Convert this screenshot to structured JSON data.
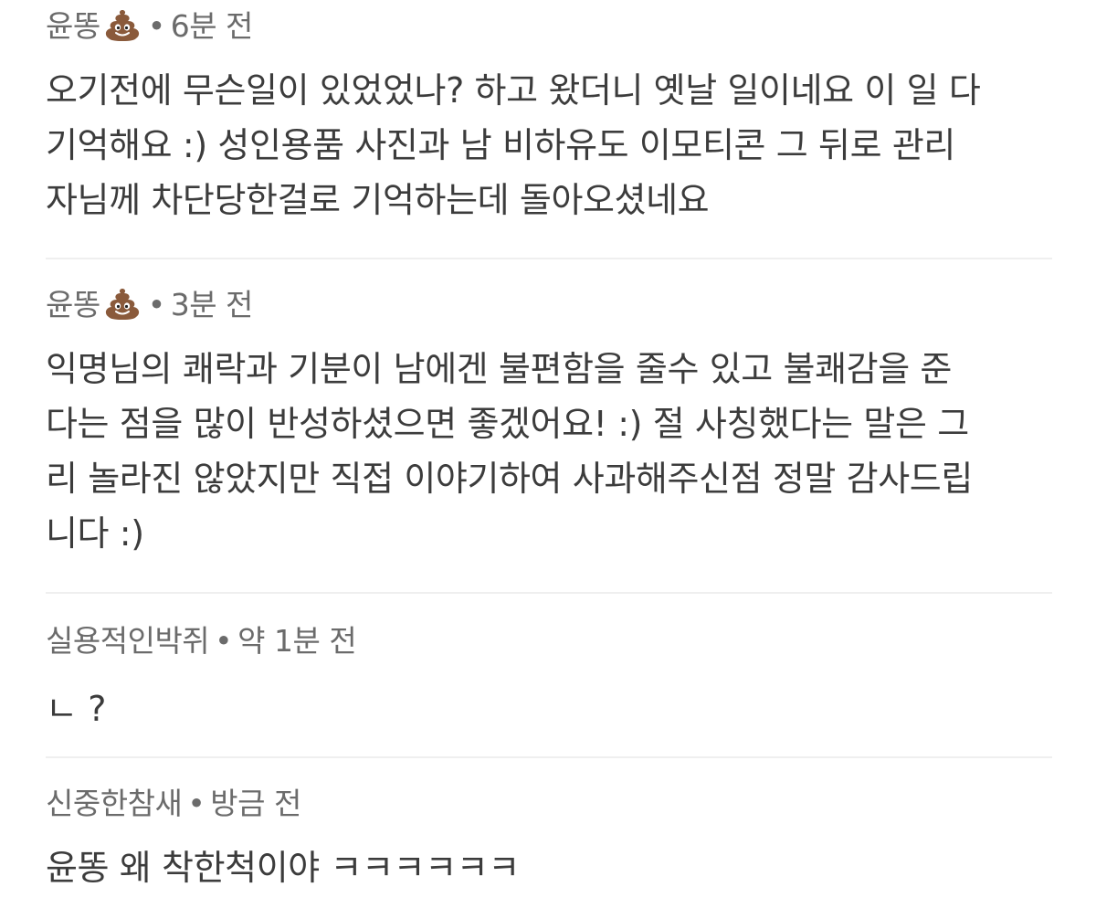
{
  "comments": [
    {
      "author": "윤똥",
      "author_icon": "poop-emoji-icon",
      "separator": "•",
      "time": "6분 전",
      "lines": [
        "오기전에 무슨일이 있었었나? 하고 왔더니 옛날 일이네요 이 일 다",
        "기억해요 :) 성인용품 사진과 남 비하유도 이모티콘 그 뒤로 관리",
        "자님께 차단당한걸로 기억하는데 돌아오셨네요"
      ]
    },
    {
      "author": "윤똥",
      "author_icon": "poop-emoji-icon",
      "separator": "•",
      "time": "3분 전",
      "lines": [
        "익명님의 쾌락과 기분이 남에겐 불편함을 줄수 있고 불쾌감을 준",
        "다는 점을 많이 반성하셨으면 좋겠어요! :) 절 사칭했다는 말은 그",
        "리 놀라진 않았지만 직접 이야기하여 사과해주신점 정말 감사드립",
        "니다 :)"
      ]
    },
    {
      "author": "실용적인박쥐",
      "separator": "•",
      "time": "약 1분 전",
      "lines": [
        "ㄴ ?"
      ]
    },
    {
      "author": "신중한참새",
      "separator": "•",
      "time": "방금 전",
      "lines": [
        "윤똥 왜 착한척이야 ㅋㅋㅋㅋㅋㅋ"
      ]
    }
  ],
  "colors": {
    "meta_text": "#6b6b6b",
    "body_text": "#3c3c3c",
    "divider": "#efefef",
    "emoji_brown": "#8a5a3b"
  }
}
